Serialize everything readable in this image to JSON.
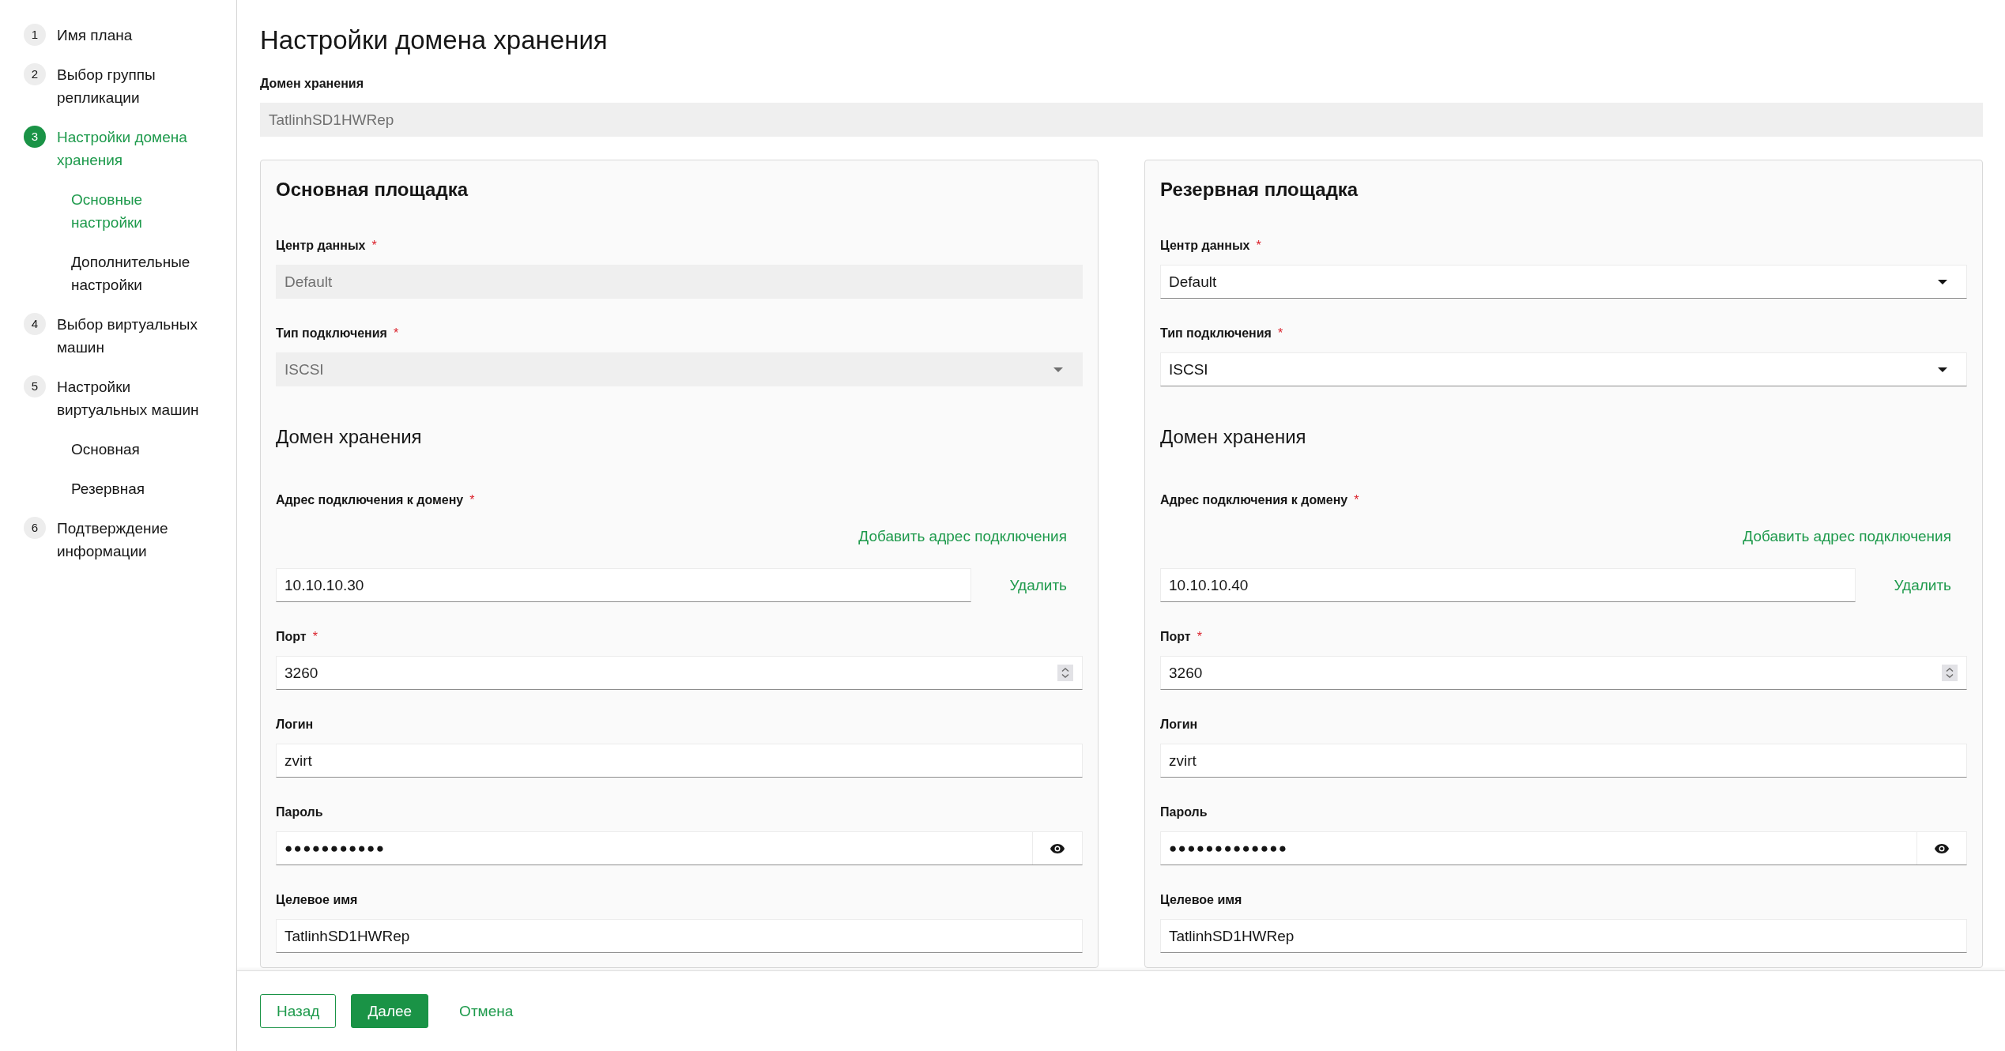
{
  "sidebar": {
    "steps": [
      {
        "number": "1",
        "label": "Имя плана",
        "selected": false
      },
      {
        "number": "2",
        "label": "Выбор группы репликации",
        "selected": false
      },
      {
        "number": "3",
        "label": "Настройки домена хранения",
        "selected": true,
        "children": [
          {
            "label": "Основные настройки",
            "selected": true
          },
          {
            "label": "Дополнительные настройки",
            "selected": false
          }
        ]
      },
      {
        "number": "4",
        "label": "Выбор виртуальных машин",
        "selected": false
      },
      {
        "number": "5",
        "label": "Настройки виртуальных машин",
        "selected": false,
        "children": [
          {
            "label": "Основная",
            "selected": false
          },
          {
            "label": "Резервная",
            "selected": false
          }
        ]
      },
      {
        "number": "6",
        "label": "Подтверждение информации",
        "selected": false
      }
    ]
  },
  "page_title": "Настройки домена хранения",
  "storage_domain": {
    "label": "Домен хранения",
    "value": "TatlinhSD1HWRep",
    "disabled": true
  },
  "sites": [
    {
      "title": "Основная площадка",
      "fields": [
        {
          "kind": "text",
          "label": "Центр данных",
          "required_mark": "*",
          "value": "Default",
          "disabled": true
        },
        {
          "kind": "select",
          "label": "Тип подключения",
          "required_mark": "*",
          "value": "ISCSI",
          "disabled": true
        },
        {
          "kind": "heading",
          "title": "Домен хранения"
        },
        {
          "kind": "address-list",
          "label": "Адрес подключения к домену",
          "required_mark": "*",
          "add_link": "Добавить адрес подключения",
          "addresses": [
            {
              "value": "10.10.10.30",
              "remove_link": "Удалить"
            }
          ]
        },
        {
          "kind": "number",
          "label": "Порт",
          "required_mark": "*",
          "value": "3260",
          "disabled": false
        },
        {
          "kind": "text",
          "label": "Логин",
          "value": "zvirt",
          "disabled": false
        },
        {
          "kind": "password",
          "label": "Пароль",
          "value": "●●●●●●●●●●●",
          "disabled": false
        },
        {
          "kind": "text",
          "label": "Целевое имя",
          "value": "TatlinhSD1HWRep",
          "disabled": false
        }
      ]
    },
    {
      "title": "Резервная площадка",
      "fields": [
        {
          "kind": "select",
          "label": "Центр данных",
          "required_mark": "*",
          "value": "Default",
          "disabled": false
        },
        {
          "kind": "select",
          "label": "Тип подключения",
          "required_mark": "*",
          "value": "ISCSI",
          "disabled": false
        },
        {
          "kind": "heading",
          "title": "Домен хранения"
        },
        {
          "kind": "address-list",
          "label": "Адрес подключения к домену",
          "required_mark": "*",
          "add_link": "Добавить адрес подключения",
          "addresses": [
            {
              "value": "10.10.10.40",
              "remove_link": "Удалить"
            }
          ]
        },
        {
          "kind": "number",
          "label": "Порт",
          "required_mark": "*",
          "value": "3260",
          "disabled": false
        },
        {
          "kind": "text",
          "label": "Логин",
          "value": "zvirt",
          "disabled": false
        },
        {
          "kind": "password",
          "label": "Пароль",
          "value": "●●●●●●●●●●●●●",
          "disabled": false
        },
        {
          "kind": "text",
          "label": "Целевое имя",
          "value": "TatlinhSD1HWRep",
          "disabled": false
        }
      ]
    }
  ],
  "footer": {
    "buttons": [
      {
        "kind": "outline",
        "label": "Назад"
      },
      {
        "kind": "primary",
        "label": "Далее"
      },
      {
        "kind": "link",
        "label": "Отмена"
      }
    ]
  }
}
